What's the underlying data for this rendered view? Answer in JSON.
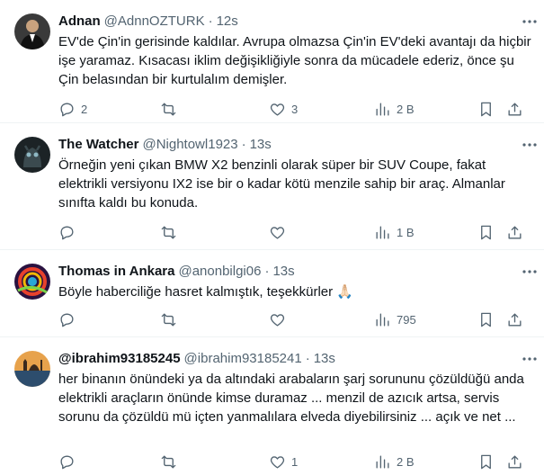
{
  "tweets": [
    {
      "name": "Adnan",
      "handle": "@AdnnOZTURK",
      "time": "12s",
      "text": "EV'de Çin'in gerisinde kaldılar. Avrupa olmazsa Çin'in EV'deki avantajı da hiçbir işe yaramaz. Kısacası iklim değişikliğiyle sonra da mücadele ederiz, önce şu Çin belasından bir kurtulalım demişler.",
      "replies": "2",
      "retweets": "",
      "likes": "3",
      "views": "2 B"
    },
    {
      "name": "The Watcher",
      "handle": "@Nightowl1923",
      "time": "13s",
      "text": "Örneğin yeni çıkan BMW X2 benzinli olarak süper bir SUV Coupe, fakat elektrikli versiyonu IX2 ise bir o kadar kötü menzile sahip bir araç.  Almanlar sınıfta kaldı bu konuda.",
      "replies": "",
      "retweets": "",
      "likes": "",
      "views": "1 B"
    },
    {
      "name": "Thomas in Ankara",
      "handle": "@anonbilgi06",
      "time": "13s",
      "text": "Böyle haberciliğe hasret kalmıştık, teşekkürler 🙏🏻",
      "replies": "",
      "retweets": "",
      "likes": "",
      "views": "795"
    },
    {
      "name": "@ibrahim93185245",
      "handle": "@ibrahim93185241",
      "time": "13s",
      "text": "her binanın önündeki ya da altındaki arabaların şarj sorununu çözüldüğü anda elektrikli araçların önünde kimse duramaz ... menzil de azıcık artsa, servis sorunu da çözüldü mü içten yanmalılara elveda diyebilirsiniz ... açık ve net ...",
      "replies": "",
      "retweets": "",
      "likes": "1",
      "views": "2 B"
    }
  ],
  "icons": {
    "reply": "reply-icon",
    "retweet": "retweet-icon",
    "like": "heart-icon",
    "views": "views-chart-icon",
    "bookmark": "bookmark-icon",
    "share": "share-icon",
    "more": "more-dots-icon"
  },
  "colors": {
    "text": "#0f1419",
    "secondary": "#536471",
    "divider": "#eff3f4"
  }
}
